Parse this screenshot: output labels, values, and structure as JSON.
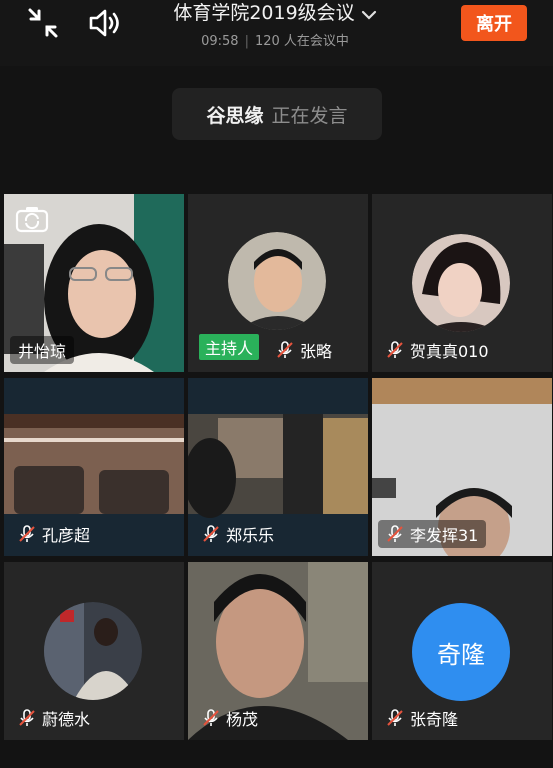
{
  "header": {
    "title": "体育学院2019级会议",
    "time": "09:58",
    "attendee_count": "120 人在会议中",
    "leave_label": "离开"
  },
  "speaker": {
    "name": "谷思缘",
    "status": "正在发言"
  },
  "host_badge": "主持人",
  "participants": [
    {
      "name": "井怡琼",
      "muted": false
    },
    {
      "name": "张略",
      "muted": true,
      "host": true
    },
    {
      "name": "贺真真010",
      "muted": true
    },
    {
      "name": "孔彦超",
      "muted": true
    },
    {
      "name": "郑乐乐",
      "muted": true
    },
    {
      "name": "李发挥31",
      "muted": true
    },
    {
      "name": "蔚德水",
      "muted": true
    },
    {
      "name": "杨茂",
      "muted": true
    },
    {
      "name": "张奇隆",
      "muted": true,
      "avatar_text": "奇隆"
    }
  ],
  "colors": {
    "leave": "#f2561c",
    "host": "#2ab15a",
    "avatar": "#2f8ef0",
    "muted_icon": "#e5533d"
  }
}
